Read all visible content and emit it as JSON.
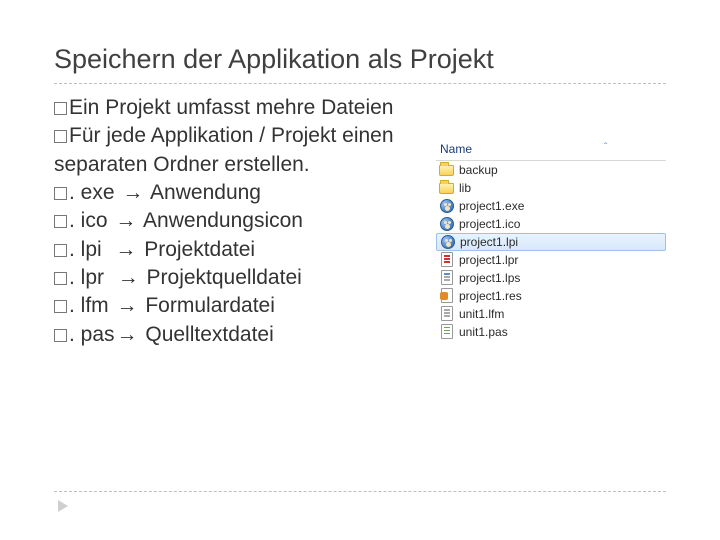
{
  "title": "Speichern der Applikation als Projekt",
  "bullets": {
    "b1_a": "Ein",
    "b1_b": " Projekt umfasst mehre Dateien",
    "b2_a": "Für",
    "b2_b": " jede Applikation / Projekt einen separaten Ordner erstellen.",
    "b3_ext": ". exe",
    "b3_desc": " Anwendung",
    "b4_ext": ". ico",
    "b4_desc": " Anwendungsicon",
    "b5_ext": ". lpi",
    "b5_desc": " Projektdatei",
    "b6_ext": ". lpr",
    "b6_desc": " Projektquelldatei",
    "b7_ext": ". lfm",
    "b7_desc": " Formulardatei",
    "b8_ext": ". pas",
    "b8_desc": " Quelltextdatei",
    "arrow": "→"
  },
  "explorer": {
    "header": "Name",
    "sort": "ˆ",
    "rows": [
      {
        "name": "backup",
        "type": "folder"
      },
      {
        "name": "lib",
        "type": "folder"
      },
      {
        "name": "project1.exe",
        "type": "paw"
      },
      {
        "name": "project1.ico",
        "type": "paw"
      },
      {
        "name": "project1.lpi",
        "type": "paw",
        "selected": true
      },
      {
        "name": "project1.lpr",
        "type": "page-red"
      },
      {
        "name": "project1.lps",
        "type": "page-blue"
      },
      {
        "name": "project1.res",
        "type": "page-orange"
      },
      {
        "name": "unit1.lfm",
        "type": "page-grey"
      },
      {
        "name": "unit1.pas",
        "type": "page-green"
      }
    ]
  }
}
